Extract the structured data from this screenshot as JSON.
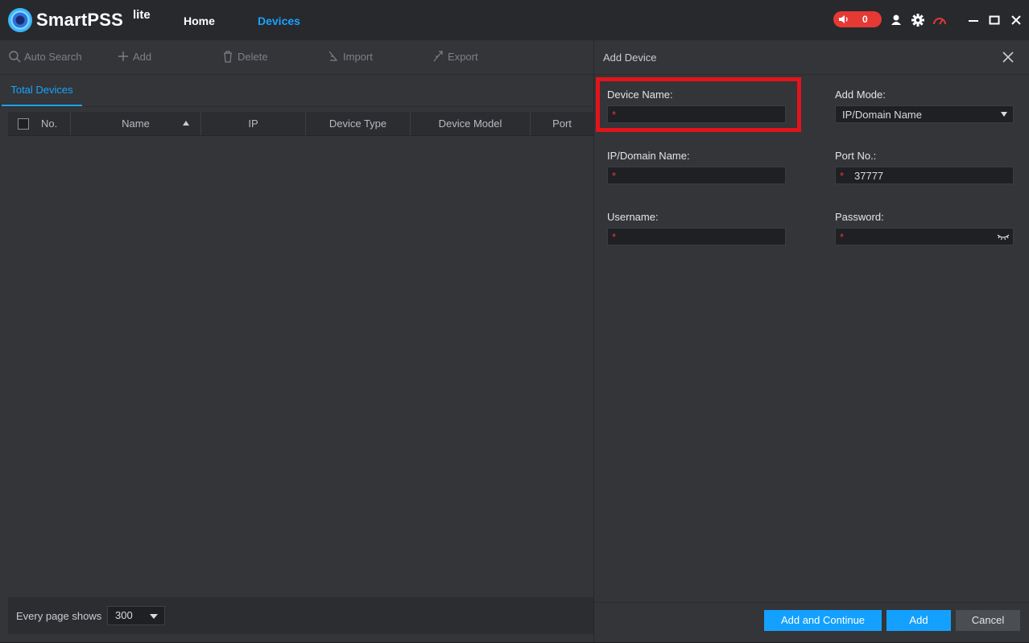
{
  "app": {
    "brand": "SmartPSS",
    "brand_suffix": "lite"
  },
  "nav": {
    "home": "Home",
    "devices": "Devices"
  },
  "alarm": {
    "count": "0"
  },
  "toolbar": {
    "auto_search": "Auto Search",
    "add": "Add",
    "delete": "Delete",
    "import": "Import",
    "export": "Export"
  },
  "tabs": {
    "total_devices": "Total Devices"
  },
  "table": {
    "columns": [
      "No.",
      "Name",
      "IP",
      "Device Type",
      "Device Model",
      "Port"
    ],
    "rows": []
  },
  "pagination": {
    "label": "Every page shows",
    "value": "300"
  },
  "dialog": {
    "title": "Add Device",
    "device_name": {
      "label": "Device Name:",
      "value": ""
    },
    "add_mode": {
      "label": "Add Mode:",
      "value": "IP/Domain Name"
    },
    "ip": {
      "label": "IP/Domain Name:",
      "value": ""
    },
    "port": {
      "label": "Port No.:",
      "value": "37777"
    },
    "username": {
      "label": "Username:",
      "value": ""
    },
    "password": {
      "label": "Password:",
      "value": ""
    },
    "required_mark": "*",
    "buttons": {
      "add_continue": "Add and Continue",
      "add": "Add",
      "cancel": "Cancel"
    }
  },
  "colors": {
    "accent": "#1aa3ff",
    "alarm": "#e53935",
    "highlight": "#e3141b"
  }
}
